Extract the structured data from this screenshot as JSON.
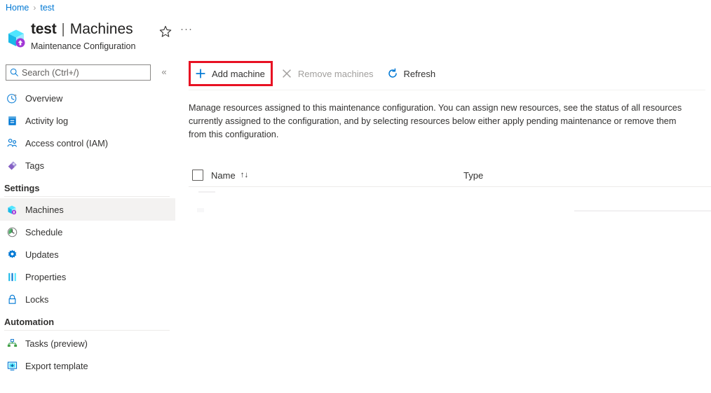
{
  "breadcrumb": {
    "items": [
      {
        "label": "Home",
        "link": true
      },
      {
        "label": "test",
        "link": true
      }
    ],
    "separator": "›"
  },
  "header": {
    "resource_icon": "maintenance-configuration-cube-icon",
    "title": "test",
    "pipe": "|",
    "section": "Machines",
    "subtitle": "Maintenance Configuration",
    "favorite_icon": "star-icon",
    "more_icon": "ellipsis-icon",
    "more_label": "···"
  },
  "sidebar": {
    "search": {
      "icon": "search-icon",
      "placeholder": "Search (Ctrl+/)",
      "value": ""
    },
    "collapse": {
      "icon": "chevron-double-left-icon",
      "label": "«"
    },
    "items": [
      {
        "label": "Overview",
        "icon": "overview-icon",
        "selected": false
      },
      {
        "label": "Activity log",
        "icon": "activity-log-icon",
        "selected": false
      },
      {
        "label": "Access control (IAM)",
        "icon": "access-control-icon",
        "selected": false
      },
      {
        "label": "Tags",
        "icon": "tags-icon",
        "selected": false
      }
    ],
    "groups": [
      {
        "title": "Settings",
        "items": [
          {
            "label": "Machines",
            "icon": "machines-cube-icon",
            "selected": true
          },
          {
            "label": "Schedule",
            "icon": "schedule-clock-icon",
            "selected": false
          },
          {
            "label": "Updates",
            "icon": "updates-gear-icon",
            "selected": false
          },
          {
            "label": "Properties",
            "icon": "properties-bars-icon",
            "selected": false
          },
          {
            "label": "Locks",
            "icon": "lock-icon",
            "selected": false
          }
        ]
      },
      {
        "title": "Automation",
        "items": [
          {
            "label": "Tasks (preview)",
            "icon": "tasks-hierarchy-icon",
            "selected": false
          },
          {
            "label": "Export template",
            "icon": "export-template-icon",
            "selected": false
          }
        ]
      }
    ]
  },
  "toolbar": {
    "add_machine": {
      "label": "Add machine",
      "icon": "plus-icon",
      "disabled": false,
      "highlighted": true
    },
    "remove_machines": {
      "label": "Remove machines",
      "icon": "cross-icon",
      "disabled": true,
      "highlighted": false
    },
    "refresh": {
      "label": "Refresh",
      "icon": "refresh-icon",
      "disabled": false,
      "highlighted": false
    }
  },
  "main": {
    "description": "Manage resources assigned to this maintenance configuration. You can assign new resources, see the status of all resources currently assigned to the configuration, and by selecting resources below either apply pending maintenance or remove them from this configuration."
  },
  "table": {
    "select_all_checkbox": {
      "icon": "checkbox-unchecked-icon",
      "checked": false
    },
    "columns": [
      {
        "label": "Name",
        "sort_icon": "sort-arrows-icon",
        "sort_glyph": "↑↓"
      },
      {
        "label": "Type",
        "sort_icon": "",
        "sort_glyph": ""
      }
    ],
    "rows": []
  },
  "colors": {
    "accent": "#0078d4",
    "highlight_box": "#e81123",
    "selected_row": "#f3f2f1",
    "text": "#323130",
    "disabled_text": "#a19f9d"
  }
}
